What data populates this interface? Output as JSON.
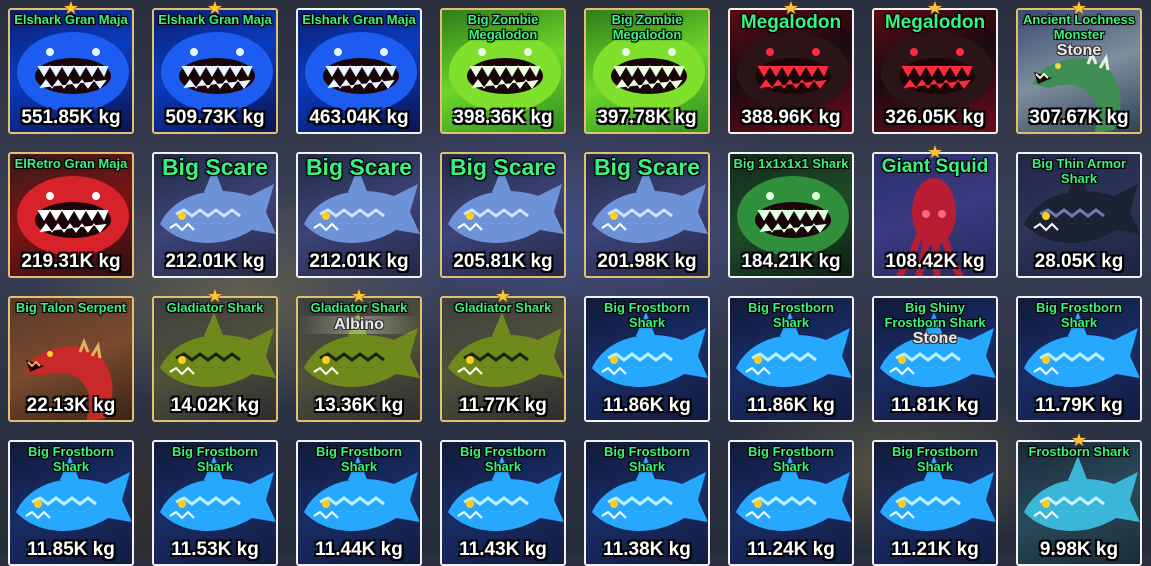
{
  "colors": {
    "name_text": "#3cf27e",
    "weight_text": "#ffffff",
    "border_gold": "#e3c06f",
    "border_white": "#f2f2f2",
    "star": "#ffc23a"
  },
  "cards": [
    {
      "name": "Elshark Gran Maja",
      "weight": "551.85K kg",
      "star": true,
      "mutation": "",
      "theme": "elshark",
      "style": "nowrap",
      "border": "gold"
    },
    {
      "name": "Elshark Gran Maja",
      "weight": "509.73K kg",
      "star": true,
      "mutation": "",
      "theme": "elshark",
      "style": "nowrap",
      "border": "gold"
    },
    {
      "name": "Elshark Gran Maja",
      "weight": "463.04K kg",
      "star": false,
      "mutation": "",
      "theme": "elshark",
      "style": "nowrap",
      "border": "white"
    },
    {
      "name": "Big Zombie\nMegalodon",
      "weight": "398.36K kg",
      "star": false,
      "mutation": "",
      "theme": "zombie",
      "style": "",
      "border": "gold"
    },
    {
      "name": "Big Zombie\nMegalodon",
      "weight": "397.78K kg",
      "star": false,
      "mutation": "",
      "theme": "zombie",
      "style": "",
      "border": "gold"
    },
    {
      "name": "Megalodon",
      "weight": "388.96K kg",
      "star": true,
      "mutation": "",
      "theme": "megalodon",
      "style": "mid",
      "border": "white"
    },
    {
      "name": "Megalodon",
      "weight": "326.05K kg",
      "star": true,
      "mutation": "",
      "theme": "megalodon",
      "style": "mid",
      "border": "white"
    },
    {
      "name": "Ancient Lochness\nMonster",
      "weight": "307.67K kg",
      "star": true,
      "mutation": "Stone",
      "theme": "lochness",
      "style": "",
      "border": "gold"
    },
    {
      "name": "ElRetro Gran Maja",
      "weight": "219.31K kg",
      "star": false,
      "mutation": "",
      "theme": "elretro",
      "style": "nowrap",
      "border": "gold"
    },
    {
      "name": "Big Scare",
      "weight": "212.01K kg",
      "star": false,
      "mutation": "",
      "theme": "scare",
      "style": "big",
      "border": "white"
    },
    {
      "name": "Big Scare",
      "weight": "212.01K kg",
      "star": false,
      "mutation": "",
      "theme": "scare",
      "style": "big",
      "border": "white"
    },
    {
      "name": "Big Scare",
      "weight": "205.81K kg",
      "star": false,
      "mutation": "",
      "theme": "scare",
      "style": "big",
      "border": "gold"
    },
    {
      "name": "Big Scare",
      "weight": "201.98K kg",
      "star": false,
      "mutation": "",
      "theme": "scare",
      "style": "big",
      "border": "gold"
    },
    {
      "name": "Big 1x1x1x1 Shark",
      "weight": "184.21K kg",
      "star": false,
      "mutation": "",
      "theme": "onex",
      "style": "nowrap",
      "border": "white"
    },
    {
      "name": "Giant Squid",
      "weight": "108.42K kg",
      "star": true,
      "mutation": "",
      "theme": "squid",
      "style": "mid",
      "border": "white"
    },
    {
      "name": "Big Thin Armor\nShark",
      "weight": "28.05K kg",
      "star": false,
      "mutation": "",
      "theme": "armor",
      "style": "",
      "border": "white"
    },
    {
      "name": "Big Talon Serpent",
      "weight": "22.13K kg",
      "star": false,
      "mutation": "",
      "theme": "talon",
      "style": "nowrap",
      "border": "gold"
    },
    {
      "name": "Gladiator Shark",
      "weight": "14.02K kg",
      "star": true,
      "mutation": "",
      "theme": "gladiator",
      "style": "nowrap",
      "border": "gold"
    },
    {
      "name": "Gladiator Shark",
      "weight": "13.36K kg",
      "star": true,
      "mutation": "Albino",
      "theme": "gladiator",
      "style": "nowrap",
      "border": "gold"
    },
    {
      "name": "Gladiator Shark",
      "weight": "11.77K kg",
      "star": true,
      "mutation": "",
      "theme": "gladiator",
      "style": "nowrap",
      "border": "gold"
    },
    {
      "name": "Big Frostborn\nShark",
      "weight": "11.86K kg",
      "star": false,
      "mutation": "",
      "theme": "frost",
      "style": "",
      "border": "white"
    },
    {
      "name": "Big Frostborn\nShark",
      "weight": "11.86K kg",
      "star": false,
      "mutation": "",
      "theme": "frost",
      "style": "",
      "border": "white"
    },
    {
      "name": "Big Shiny\nFrostborn Shark",
      "weight": "11.81K kg",
      "star": false,
      "mutation": "Stone",
      "theme": "frost",
      "style": "",
      "border": "white"
    },
    {
      "name": "Big Frostborn\nShark",
      "weight": "11.79K kg",
      "star": false,
      "mutation": "",
      "theme": "frost",
      "style": "",
      "border": "white"
    },
    {
      "name": "Big Frostborn\nShark",
      "weight": "11.85K kg",
      "star": false,
      "mutation": "",
      "theme": "frost",
      "style": "",
      "border": "white"
    },
    {
      "name": "Big Frostborn\nShark",
      "weight": "11.53K kg",
      "star": false,
      "mutation": "",
      "theme": "frost",
      "style": "",
      "border": "white"
    },
    {
      "name": "Big Frostborn\nShark",
      "weight": "11.44K kg",
      "star": false,
      "mutation": "",
      "theme": "frost",
      "style": "",
      "border": "white"
    },
    {
      "name": "Big Frostborn\nShark",
      "weight": "11.43K kg",
      "star": false,
      "mutation": "",
      "theme": "frost",
      "style": "",
      "border": "white"
    },
    {
      "name": "Big Frostborn\nShark",
      "weight": "11.38K kg",
      "star": false,
      "mutation": "",
      "theme": "frost",
      "style": "",
      "border": "white"
    },
    {
      "name": "Big Frostborn\nShark",
      "weight": "11.24K kg",
      "star": false,
      "mutation": "",
      "theme": "frost",
      "style": "",
      "border": "white"
    },
    {
      "name": "Big Frostborn\nShark",
      "weight": "11.21K kg",
      "star": false,
      "mutation": "",
      "theme": "frost",
      "style": "",
      "border": "white"
    },
    {
      "name": "Frostborn Shark",
      "weight": "9.98K kg",
      "star": true,
      "mutation": "",
      "theme": "frostsmall",
      "style": "nowrap",
      "border": "white"
    }
  ]
}
